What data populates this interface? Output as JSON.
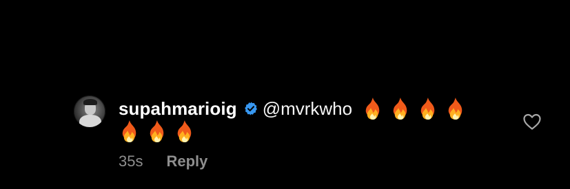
{
  "comment": {
    "username": "supahmarioig",
    "verified": true,
    "mention": "@mvrkwho",
    "emoji_name": "fire-emoji",
    "emoji_glyph": "🔥",
    "emoji_count": 7,
    "timestamp": "35s",
    "reply_label": "Reply",
    "like_icon": "heart-outline-icon"
  },
  "colors": {
    "background": "#000000",
    "text": "#ffffff",
    "muted": "#8e8e8e",
    "verified_badge": "#3797f0"
  }
}
